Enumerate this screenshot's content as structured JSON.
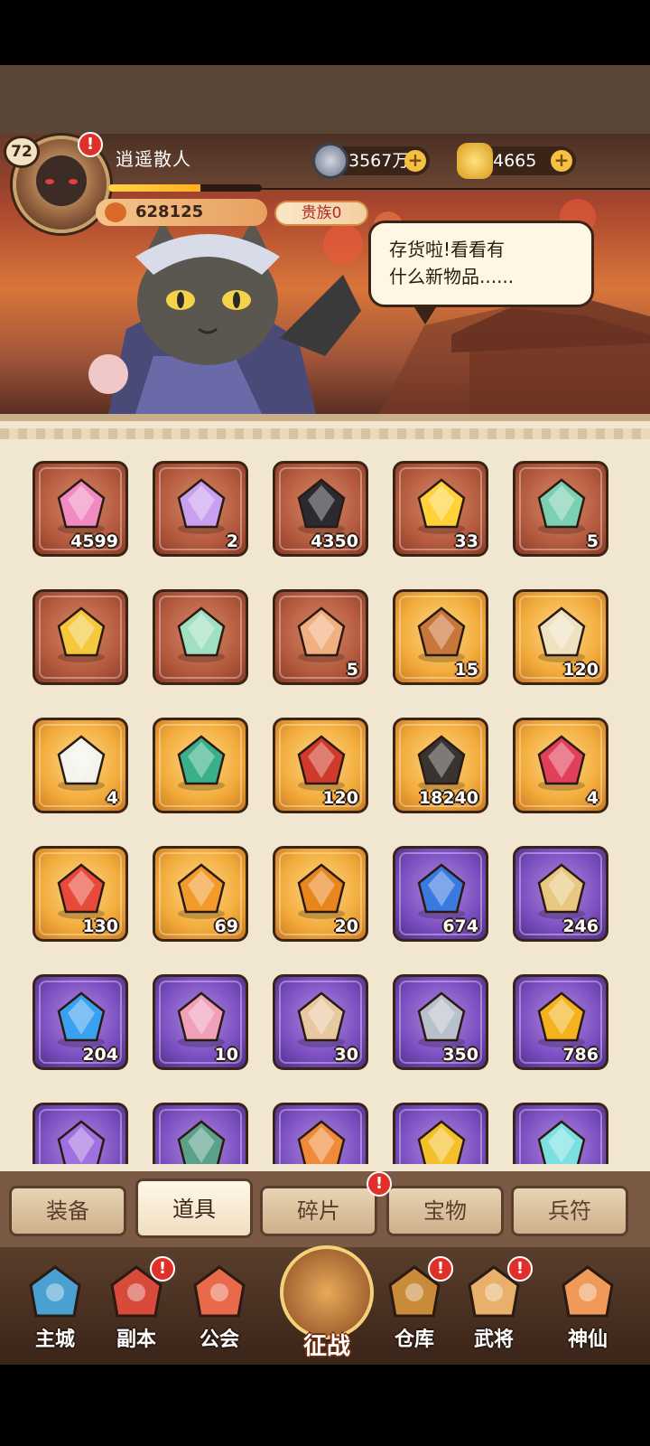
{
  "player": {
    "level": "72",
    "name": "逍遥散人",
    "power": "628125",
    "noble": "贵族0",
    "exp_fraction": 0.6
  },
  "currencies": {
    "silver": "3567万",
    "gold": "4665"
  },
  "speech": {
    "line1": "存货啦!看看有",
    "line2": "什么新物品......"
  },
  "alert_mark": "!",
  "items": [
    {
      "icon": "pink-crystal-icon",
      "count": "4599",
      "rarity": "red"
    },
    {
      "icon": "winged-helmet-chest-icon",
      "count": "2",
      "rarity": "red"
    },
    {
      "icon": "dark-iron-bar-icon",
      "count": "4350",
      "rarity": "red"
    },
    {
      "icon": "gold-star-icon",
      "count": "33",
      "rarity": "red"
    },
    {
      "icon": "jade-cube-chest-icon",
      "count": "5",
      "rarity": "red"
    },
    {
      "icon": "gold-treasure-chest-icon",
      "count": "",
      "rarity": "red"
    },
    {
      "icon": "jade-treasure-chest-icon",
      "count": "",
      "rarity": "red"
    },
    {
      "icon": "god-of-wealth-card-icon",
      "count": "5",
      "rarity": "red"
    },
    {
      "icon": "bronze-token-icon",
      "count": "15",
      "rarity": "gold"
    },
    {
      "icon": "scroll-icon",
      "count": "120",
      "rarity": "gold"
    },
    {
      "icon": "white-lotus-icon",
      "count": "4",
      "rarity": "gold"
    },
    {
      "icon": "green-gift-box-icon",
      "count": "",
      "rarity": "gold"
    },
    {
      "icon": "general-pouch-icon",
      "count": "120",
      "rarity": "gold"
    },
    {
      "icon": "black-ore-icon",
      "count": "18240",
      "rarity": "gold"
    },
    {
      "icon": "red-gem-icon",
      "count": "4",
      "rarity": "gold"
    },
    {
      "icon": "firework-icon",
      "count": "130",
      "rarity": "gold"
    },
    {
      "icon": "amber-orb-feather-icon",
      "count": "69",
      "rarity": "gold"
    },
    {
      "icon": "amber-orb-icon",
      "count": "20",
      "rarity": "gold"
    },
    {
      "icon": "blue-pearl-leaf-icon",
      "count": "674",
      "rarity": "purple"
    },
    {
      "icon": "small-scroll-icon",
      "count": "246",
      "rarity": "purple"
    },
    {
      "icon": "blue-flame-orb-icon",
      "count": "204",
      "rarity": "purple"
    },
    {
      "icon": "pink-lotus-icon",
      "count": "10",
      "rarity": "purple"
    },
    {
      "icon": "paper-ticket-icon",
      "count": "30",
      "rarity": "purple"
    },
    {
      "icon": "silver-ingot-icon",
      "count": "350",
      "rarity": "purple"
    },
    {
      "icon": "gold-coin-stone-icon",
      "count": "786",
      "rarity": "purple"
    },
    {
      "icon": "purple-gem-icon",
      "count": "",
      "rarity": "purple"
    },
    {
      "icon": "jade-pendant-icon",
      "count": "",
      "rarity": "purple"
    },
    {
      "icon": "orange-badge-icon",
      "count": "",
      "rarity": "purple"
    },
    {
      "icon": "gold-medal-icon",
      "count": "",
      "rarity": "purple"
    },
    {
      "icon": "teal-crystal-icon",
      "count": "",
      "rarity": "purple"
    }
  ],
  "tabs": [
    {
      "label": "装备",
      "active": false,
      "alert": false
    },
    {
      "label": "道具",
      "active": true,
      "alert": false
    },
    {
      "label": "碎片",
      "active": false,
      "alert": true
    },
    {
      "label": "宝物",
      "active": false,
      "alert": false
    },
    {
      "label": "兵符",
      "active": false,
      "alert": false
    }
  ],
  "nav": [
    {
      "label": "主城",
      "icon": "city-icon",
      "alert": false
    },
    {
      "label": "副本",
      "icon": "sword-icon",
      "alert": true
    },
    {
      "label": "公会",
      "icon": "guild-flag-icon",
      "alert": false
    },
    {
      "label": "征战",
      "icon": "battle-gate-icon",
      "alert": false
    },
    {
      "label": "仓库",
      "icon": "treasure-bag-icon",
      "alert": true
    },
    {
      "label": "武将",
      "icon": "general-cat-icon",
      "alert": true
    },
    {
      "label": "神仙",
      "icon": "immortal-cat-icon",
      "alert": false
    }
  ],
  "colors": {
    "rarity_red": "#b45a3e",
    "rarity_gold": "#f2ab3a",
    "rarity_purple": "#7a4ec0",
    "alert": "#e0302a"
  }
}
